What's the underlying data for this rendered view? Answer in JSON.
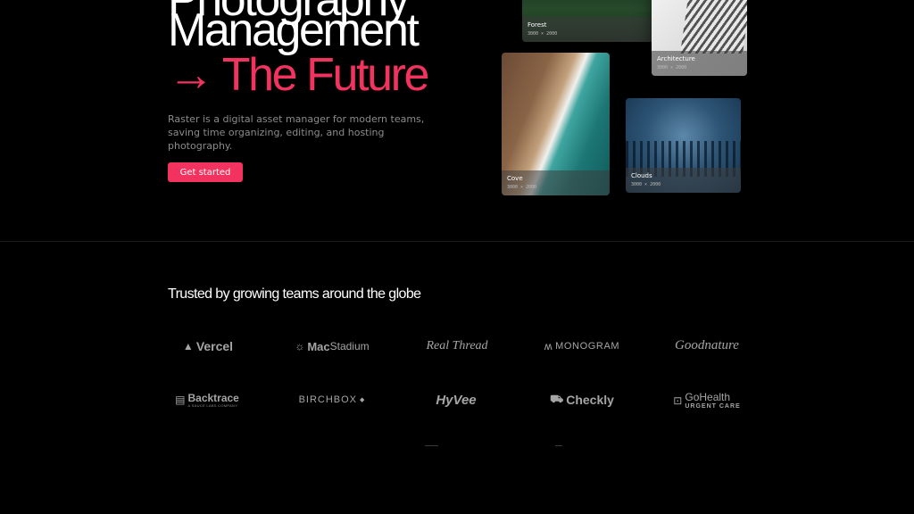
{
  "hero": {
    "title_line1": "Photography",
    "title_line2": "Management",
    "title_line3": "→ The Future",
    "description": "Raster is a digital asset manager for modern teams, saving time organizing, editing, and hosting photography.",
    "cta_label": "Get started",
    "accent_color": "#f2325f"
  },
  "cards": [
    {
      "name": "Forest",
      "size": "3000 × 2000"
    },
    {
      "name": "Architecture",
      "size": "3000 × 2000"
    },
    {
      "name": "Cove",
      "size": "3000 × 2000"
    },
    {
      "name": "Clouds",
      "size": "3000 × 2000"
    }
  ],
  "trusted": {
    "heading": "Trusted by growing teams around the globe",
    "logos": [
      {
        "name": "Vercel",
        "icon": "triangle-icon"
      },
      {
        "name": "MacStadium",
        "prefix": "Mac",
        "suffix": "Stadium",
        "icon": "sunburst-icon"
      },
      {
        "name": "Real Thread"
      },
      {
        "name": "MONOGRAM",
        "icon": "monogram-icon"
      },
      {
        "name": "Goodnature"
      },
      {
        "name": "Backtrace",
        "tagline": "A SAUCE LABS COMPANY",
        "icon": "backtrace-icon"
      },
      {
        "name": "BIRCHBOX",
        "icon": "diamond-icon"
      },
      {
        "name": "HyVee"
      },
      {
        "name": "Checkly",
        "icon": "checkly-icon"
      },
      {
        "name": "GoHealth",
        "tagline": "URGENT CARE",
        "icon": "gohealth-icon"
      }
    ]
  }
}
